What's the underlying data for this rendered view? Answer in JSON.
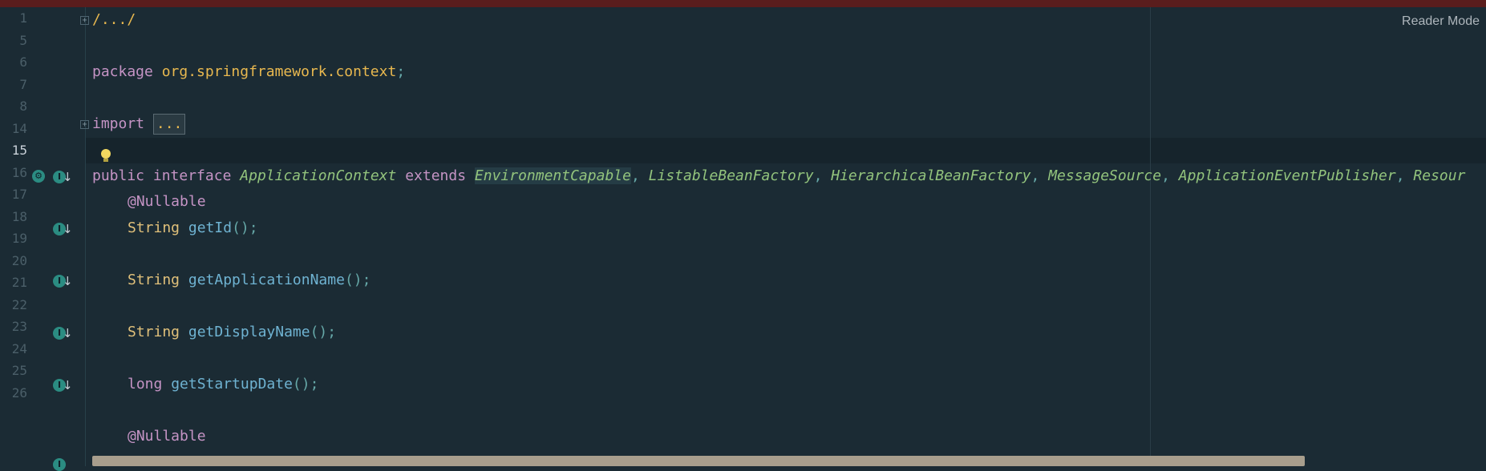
{
  "editor": {
    "reader_mode_label": "Reader Mode",
    "lines": [
      {
        "num": "1",
        "text": "/.../"
      },
      {
        "num": "5",
        "text": ""
      },
      {
        "num": "6",
        "kw": "package",
        "pkg": "org.springframework.context",
        "semi": ";"
      },
      {
        "num": "7",
        "text": ""
      },
      {
        "num": "8",
        "kw": "import",
        "collapsed": "..."
      },
      {
        "num": "14",
        "text": ""
      },
      {
        "num": "15",
        "kw1": "public",
        "kw2": "interface",
        "name": "ApplicationContext",
        "kw3": "extends",
        "supers": [
          "EnvironmentCapable",
          "ListableBeanFactory",
          "HierarchicalBeanFactory",
          "MessageSource",
          "ApplicationEventPublisher",
          "Resour"
        ]
      },
      {
        "num": "16",
        "ann": "@Nullable"
      },
      {
        "num": "17",
        "type": "String",
        "method": "getId",
        "tail": "();"
      },
      {
        "num": "18",
        "text": ""
      },
      {
        "num": "19",
        "type": "String",
        "method": "getApplicationName",
        "tail": "();"
      },
      {
        "num": "20",
        "text": ""
      },
      {
        "num": "21",
        "type": "String",
        "method": "getDisplayName",
        "tail": "();"
      },
      {
        "num": "22",
        "text": ""
      },
      {
        "num": "23",
        "type": "long",
        "method": "getStartupDate",
        "tail": "();"
      },
      {
        "num": "24",
        "text": ""
      },
      {
        "num": "25",
        "ann": "@Nullable"
      },
      {
        "num": "26",
        "text": ""
      }
    ],
    "sep": ", "
  },
  "colors": {
    "background": "#1b2b34",
    "keyword": "#c594c5",
    "package": "#e8b84f",
    "class": "#93c47d",
    "method": "#6fb3d2",
    "gutter_icon": "#2b8c82"
  },
  "icons": {
    "fold": "fold-toggle-icon",
    "implementations": "implementation-icon",
    "bulb": "lightbulb-icon",
    "gear": "implemented-by-icon"
  }
}
